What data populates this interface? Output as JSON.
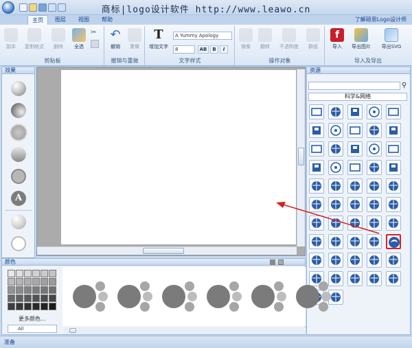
{
  "title": "商标|logo设计软件  http://www.leawo.cn",
  "tabs": [
    "主页",
    "图层",
    "视图",
    "帮助"
  ],
  "help_link": "了解硕思Logo设计师",
  "ribbon": {
    "clipboard": {
      "label": "剪贴板",
      "buttons": [
        "副本",
        "复制格式",
        "删除",
        "全选"
      ]
    },
    "undo": {
      "label": "撤销与重做",
      "buttons": [
        "撤销",
        "重做"
      ]
    },
    "text": {
      "label": "文字样式",
      "add_text": "增加文字",
      "font_name": "A Yummy Apology",
      "font_size": "8",
      "style_buttons": [
        "AB",
        "B",
        "I"
      ]
    },
    "arrange": {
      "label": "操作对象",
      "buttons": [
        "镜像",
        "翻转",
        "不透明度",
        "群组"
      ]
    },
    "io": {
      "label": "导入及导出",
      "buttons": [
        "导入",
        "导出图片",
        "导出SVG"
      ]
    }
  },
  "effects": {
    "label": "效果"
  },
  "resources": {
    "label": "资源",
    "search_value": "",
    "category": "科学&网络"
  },
  "colors": {
    "label": "颜色",
    "more": "更多颜色...",
    "palette_select": "All"
  },
  "status": "准备",
  "accent": "#d62020"
}
